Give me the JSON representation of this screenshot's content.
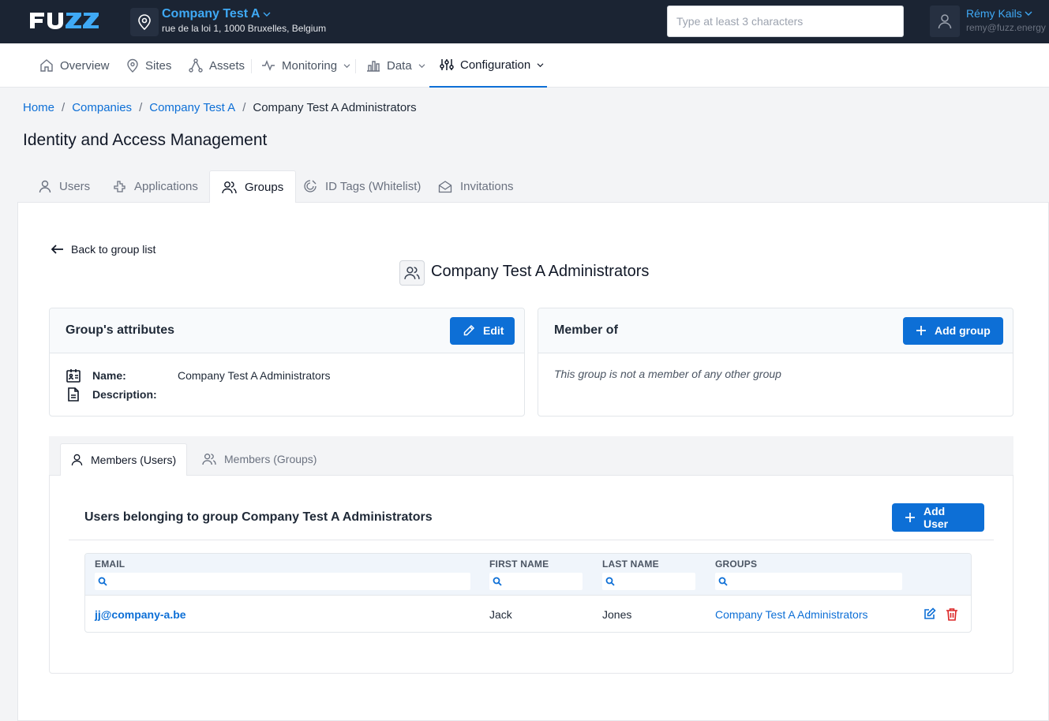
{
  "header": {
    "brand": "FUZZ",
    "company_name": "Company Test A",
    "company_address": "rue de la loi 1, 1000 Bruxelles, Belgium",
    "search_placeholder": "Type at least 3 characters",
    "user_name": "Rémy Kails",
    "user_email": "remy@fuzz.energy"
  },
  "nav": {
    "items": [
      {
        "label": "Overview",
        "icon": "home-icon"
      },
      {
        "label": "Sites",
        "icon": "map-pin-icon"
      },
      {
        "label": "Assets",
        "icon": "assets-icon"
      },
      {
        "label": "Monitoring",
        "icon": "activity-icon"
      },
      {
        "label": "Data",
        "icon": "bar-chart-icon"
      },
      {
        "label": "Configuration",
        "icon": "sliders-icon"
      }
    ],
    "active": "Configuration"
  },
  "breadcrumb": [
    "Home",
    "Companies",
    "Company Test A",
    "Company Test A Administrators"
  ],
  "page_title": "Identity and Access Management",
  "main_tabs": [
    {
      "label": "Users",
      "icon": "user-icon"
    },
    {
      "label": "Applications",
      "icon": "puzzle-icon"
    },
    {
      "label": "Groups",
      "icon": "users-icon"
    },
    {
      "label": "ID Tags (Whitelist)",
      "icon": "tag-icon"
    },
    {
      "label": "Invitations",
      "icon": "envelope-icon"
    }
  ],
  "active_main_tab": "Groups",
  "back_link": "Back to group list",
  "group_title": "Company Test A Administrators",
  "attributes_card": {
    "title": "Group's attributes",
    "edit_label": "Edit",
    "name_label": "Name:",
    "name_value": "Company Test A Administrators",
    "description_label": "Description:",
    "description_value": ""
  },
  "member_of_card": {
    "title": "Member of",
    "add_label": "Add group",
    "empty_text": "This group is not a member of any other group"
  },
  "sub_tabs": [
    {
      "label": "Members (Users)",
      "icon": "user-icon"
    },
    {
      "label": "Members (Groups)",
      "icon": "users-icon"
    }
  ],
  "active_sub_tab": "Members (Users)",
  "users_section": {
    "heading": "Users belonging to group Company Test A Administrators",
    "add_label": "Add User",
    "columns": [
      "EMAIL",
      "FIRST NAME",
      "LAST NAME",
      "GROUPS"
    ],
    "rows": [
      {
        "email": "jj@company-a.be",
        "first_name": "Jack",
        "last_name": "Jones",
        "groups": "Company Test A Administrators"
      }
    ]
  },
  "colors": {
    "topbar": "#1b2433",
    "accent": "#0d6fd6",
    "link": "#3fa9f5",
    "danger": "#dc2626"
  }
}
